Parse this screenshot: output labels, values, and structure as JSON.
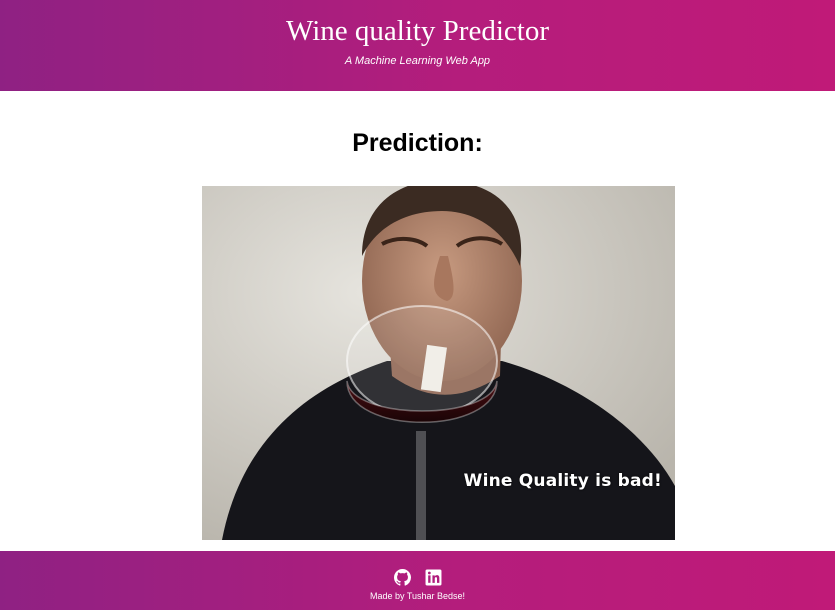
{
  "header": {
    "title": "Wine quality Predictor",
    "subtitle": "A Machine Learning Web App"
  },
  "main": {
    "heading": "Prediction:",
    "result_image": {
      "caption": "Wine Quality is bad!"
    }
  },
  "footer": {
    "icons": [
      "github-icon",
      "linkedin-icon"
    ],
    "credit": "Made by Tushar Bedse!"
  },
  "colors": {
    "gradient_start": "#8f2183",
    "gradient_end": "#c01a78",
    "text_on_bar": "#ffffff"
  }
}
